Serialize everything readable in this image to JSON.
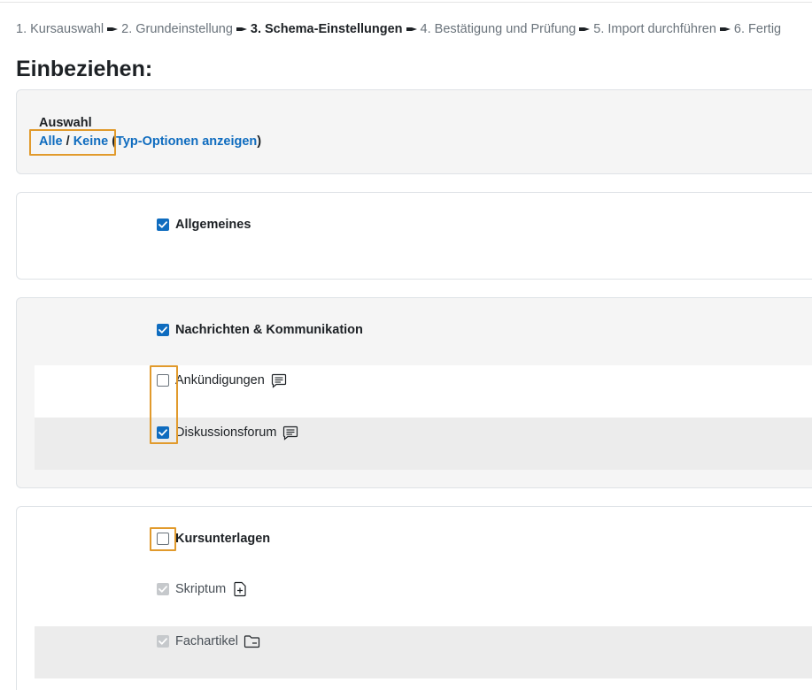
{
  "breadcrumb": {
    "steps": [
      "1. Kursauswahl",
      "2. Grundeinstellung",
      "3. Schema-Einstellungen",
      "4. Bestätigung und Prüfung",
      "5. Import durchführen",
      "6. Fertig"
    ],
    "current_index": 2
  },
  "page": {
    "title": "Einbeziehen:"
  },
  "selection": {
    "label": "Auswahl",
    "all": "Alle",
    "slash": " / ",
    "none": "Keine",
    "paren_open": " (",
    "type_options": "Typ-Optionen anzeigen",
    "paren_close": ")"
  },
  "sections": [
    {
      "label": "Allgemeines",
      "checked": true,
      "items": []
    },
    {
      "label": "Nachrichten & Kommunikation",
      "checked": true,
      "items": [
        {
          "label": "Ankündigungen",
          "checked": false,
          "icon": "forum-icon"
        },
        {
          "label": "Diskussionsforum",
          "checked": true,
          "icon": "forum-icon"
        }
      ]
    },
    {
      "label": "Kursunterlagen",
      "checked": false,
      "items": [
        {
          "label": "Skriptum",
          "checked": true,
          "disabled": true,
          "icon": "file-add-icon"
        },
        {
          "label": "Fachartikel",
          "checked": true,
          "disabled": true,
          "icon": "folder-icon"
        }
      ]
    }
  ],
  "colors": {
    "link": "#0f6cbf",
    "checkbox_checked": "#0f6cbf",
    "highlight": "#e19a2c",
    "card_gray": "#f5f5f5",
    "row_shade": "#ececec"
  }
}
